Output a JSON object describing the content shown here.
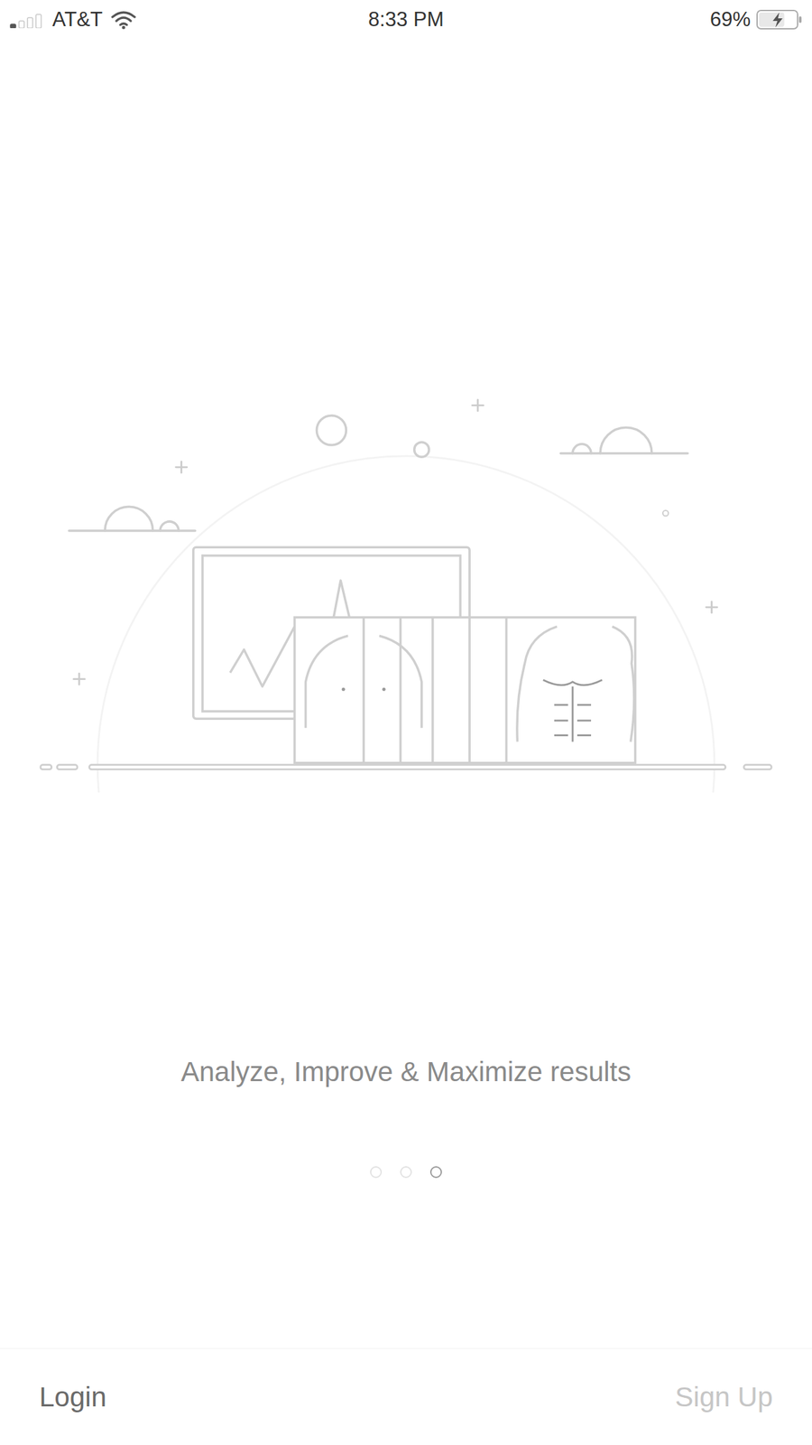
{
  "status_bar": {
    "carrier": "AT&T",
    "time": "8:33 PM",
    "battery": "69%",
    "battery_level": 0.69,
    "charging": true,
    "signal_level": 0.25
  },
  "caption": "Analyze, Improve & Maximize results",
  "pages": [
    {
      "selected": false
    },
    {
      "selected": false
    },
    {
      "selected": true
    }
  ],
  "buttons": [
    {
      "label": "Login",
      "disabled": false
    },
    {
      "label": "Sign Up",
      "disabled": true
    }
  ]
}
